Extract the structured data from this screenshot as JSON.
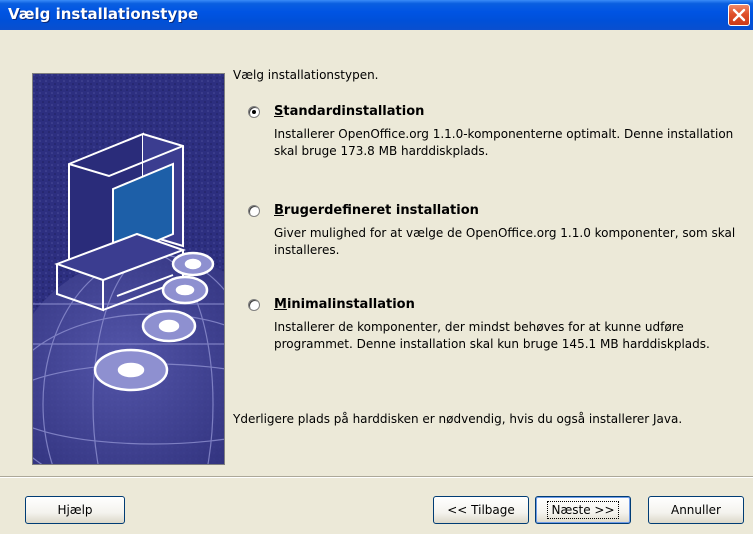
{
  "window": {
    "title": "Vælg installationstype"
  },
  "main": {
    "prompt": "Vælg installationstypen.",
    "options": [
      {
        "label_hotkey": "S",
        "label_rest": "tandardinstallation",
        "description": "Installerer OpenOffice.org 1.1.0-komponenterne optimalt. Denne installation skal bruge 173.8 MB harddiskplads.",
        "selected": true
      },
      {
        "label_hotkey": "B",
        "label_rest": "rugerdefineret installation",
        "description": "Giver mulighed for at vælge de OpenOffice.org 1.1.0 komponenter, som skal installeres.",
        "selected": false
      },
      {
        "label_hotkey": "M",
        "label_rest": "inimalinstallation",
        "description": "Installerer de komponenter, der mindst behøves for at kunne udføre programmet. Denne installation skal kun bruge 145.1 MB harddiskplads.",
        "selected": false
      }
    ],
    "note": "Yderligere plads på harddisken er nødvendig, hvis du også installerer Java."
  },
  "buttons": {
    "help": "Hjælp",
    "back": "<< Tilbage",
    "next": "Næste >>",
    "cancel": "Annuller"
  },
  "icons": {
    "close": "close-icon",
    "illustration": "computer-cd-illustration"
  },
  "colors": {
    "titlebar": "#0054e3",
    "dialog_bg": "#ece9d8",
    "close_button": "#e0502a",
    "illustration_bg": "#2a2c7a"
  }
}
